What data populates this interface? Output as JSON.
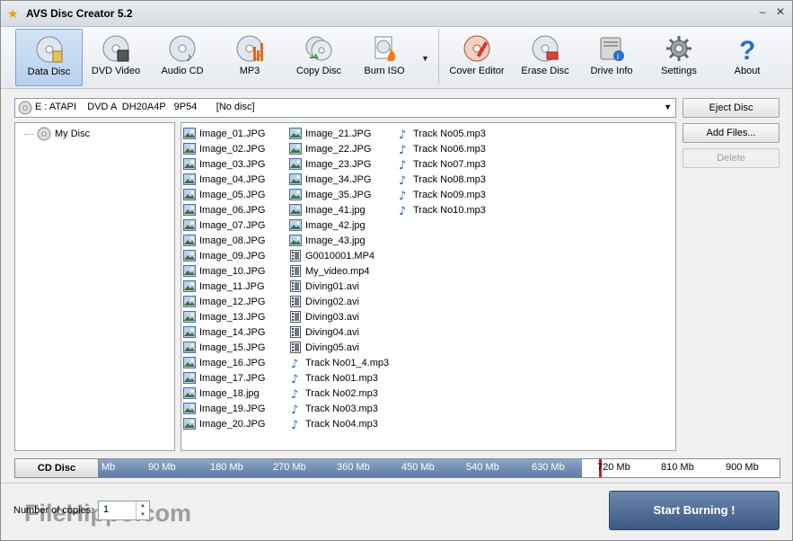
{
  "window": {
    "title": "AVS Disc Creator 5.2"
  },
  "toolbar": {
    "buttons": [
      {
        "label": "Data Disc",
        "icon": "data-disc-icon",
        "active": true
      },
      {
        "label": "DVD Video",
        "icon": "dvd-video-icon"
      },
      {
        "label": "Audio CD",
        "icon": "audio-cd-icon"
      },
      {
        "label": "MP3",
        "icon": "mp3-icon"
      },
      {
        "label": "Copy Disc",
        "icon": "copy-disc-icon"
      },
      {
        "label": "Burn ISO",
        "icon": "burn-iso-icon"
      },
      {
        "label": "Cover Editor",
        "icon": "cover-editor-icon"
      },
      {
        "label": "Erase Disc",
        "icon": "erase-disc-icon"
      },
      {
        "label": "Drive Info",
        "icon": "drive-info-icon"
      },
      {
        "label": "Settings",
        "icon": "settings-icon"
      },
      {
        "label": "About",
        "icon": "about-icon"
      }
    ]
  },
  "drive": {
    "selected": "E : ATAPI    DVD A  DH20A4P   9P54       [No disc]"
  },
  "actions": {
    "eject": "Eject Disc",
    "add": "Add Files...",
    "delete": "Delete"
  },
  "tree": {
    "root": "My Disc"
  },
  "files": {
    "col1": [
      "Image_01.JPG",
      "Image_02.JPG",
      "Image_03.JPG",
      "Image_04.JPG",
      "Image_05.JPG",
      "Image_06.JPG",
      "Image_07.JPG",
      "Image_08.JPG",
      "Image_09.JPG",
      "Image_10.JPG",
      "Image_11.JPG",
      "Image_12.JPG",
      "Image_13.JPG",
      "Image_14.JPG",
      "Image_15.JPG",
      "Image_16.JPG",
      "Image_17.JPG",
      "Image_18.jpg",
      "Image_19.JPG",
      "Image_20.JPG"
    ],
    "col2": [
      {
        "name": "Image_21.JPG",
        "type": "image"
      },
      {
        "name": "Image_22.JPG",
        "type": "image"
      },
      {
        "name": "Image_23.JPG",
        "type": "image"
      },
      {
        "name": "Image_34.JPG",
        "type": "image"
      },
      {
        "name": "Image_35.JPG",
        "type": "image"
      },
      {
        "name": "Image_41.jpg",
        "type": "image"
      },
      {
        "name": "Image_42.jpg",
        "type": "image"
      },
      {
        "name": "Image_43.jpg",
        "type": "image"
      },
      {
        "name": "G0010001.MP4",
        "type": "video"
      },
      {
        "name": "My_video.mp4",
        "type": "video"
      },
      {
        "name": "Diving01.avi",
        "type": "video"
      },
      {
        "name": "Diving02.avi",
        "type": "video"
      },
      {
        "name": "Diving03.avi",
        "type": "video"
      },
      {
        "name": "Diving04.avi",
        "type": "video"
      },
      {
        "name": "Diving05.avi",
        "type": "video"
      },
      {
        "name": "Track No01_4.mp3",
        "type": "audio"
      },
      {
        "name": "Track No01.mp3",
        "type": "audio"
      },
      {
        "name": "Track No02.mp3",
        "type": "audio"
      },
      {
        "name": "Track No03.mp3",
        "type": "audio"
      },
      {
        "name": "Track No04.mp3",
        "type": "audio"
      }
    ],
    "col3": [
      "Track No05.mp3",
      "Track No06.mp3",
      "Track No07.mp3",
      "Track No08.mp3",
      "Track No09.mp3",
      "Track No10.mp3"
    ]
  },
  "capacity": {
    "disc_type": "CD Disc",
    "ticks": [
      "Mb",
      "90 Mb",
      "180 Mb",
      "270 Mb",
      "360 Mb",
      "450 Mb",
      "540 Mb",
      "630 Mb",
      "720 Mb",
      "810 Mb",
      "900 Mb"
    ],
    "max_mb": 900,
    "limit_mb": 700,
    "used_fraction": 0.71
  },
  "copies": {
    "label": "Number of copies:",
    "value": "1"
  },
  "watermark": "FileHippo.com",
  "start": {
    "label": "Start Burning !"
  },
  "colors": {
    "accent": "#3d5a84",
    "fill": "#5b7aa5",
    "marker": "#c21f1f"
  }
}
